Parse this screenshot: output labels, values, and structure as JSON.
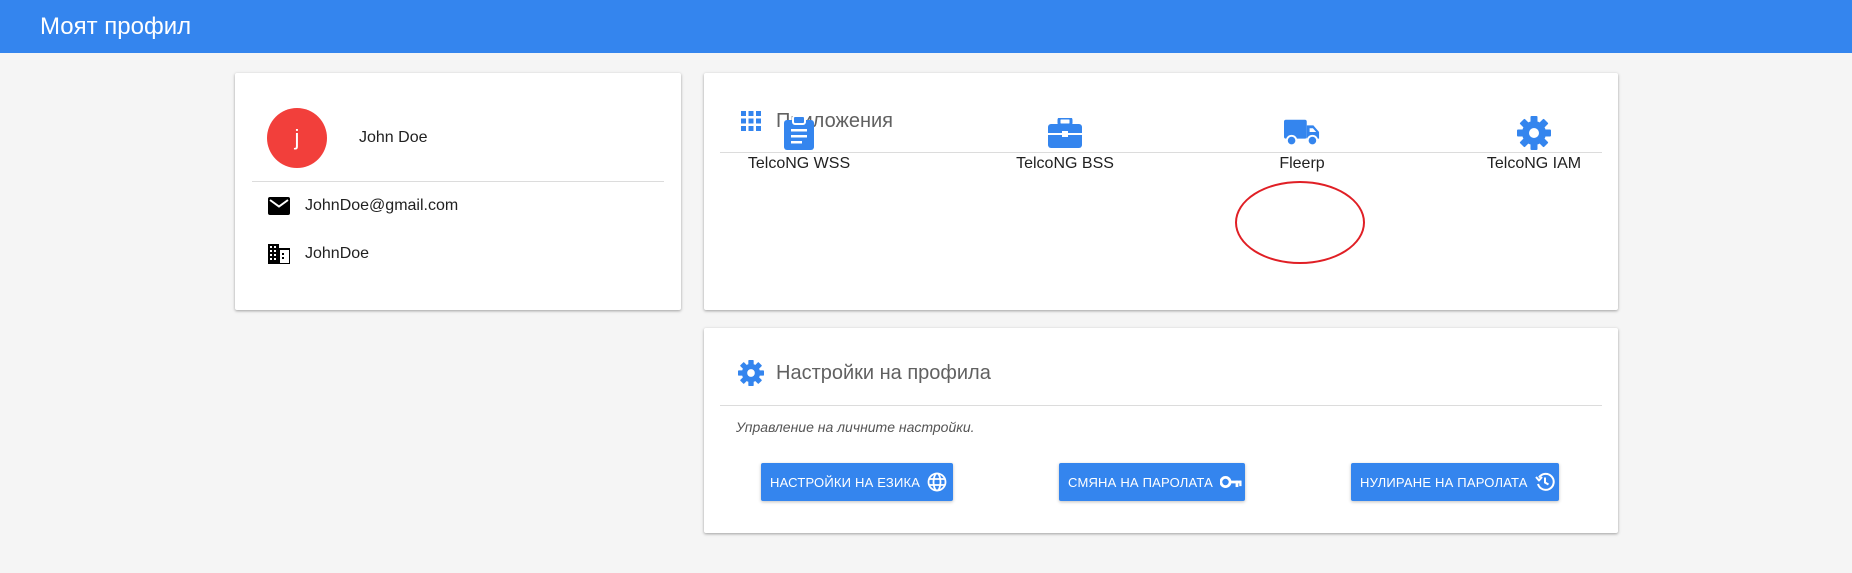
{
  "header": {
    "title": "Моят профил",
    "color": "#3485ee"
  },
  "profile": {
    "avatar_letter": "j",
    "avatar_color": "#f23f3b",
    "name": "John Doe",
    "email": "JohnDoe@gmail.com",
    "company": "JohnDoe",
    "email_icon": "mail-icon",
    "company_icon": "building-icon"
  },
  "apps": {
    "title": "Приложения",
    "icon": "apps-grid-icon",
    "items": [
      {
        "label": "TelcoNG WSS",
        "icon": "clipboard-icon"
      },
      {
        "label": "TelcoNG BSS",
        "icon": "briefcase-icon"
      },
      {
        "label": "Fleerp",
        "icon": "truck-icon",
        "highlighted": true
      },
      {
        "label": "TelcoNG IAM",
        "icon": "gear-icon"
      }
    ],
    "accent_color": "#3485ee",
    "highlight_color": "#e01f25"
  },
  "settings": {
    "title": "Настройки на профила",
    "icon": "gear-icon",
    "subtitle": "Управление на личните настройки.",
    "buttons": [
      {
        "label": "НАСТРОЙКИ НА ЕЗИКА",
        "icon": "globe-icon"
      },
      {
        "label": "СМЯНА НА ПАРОЛАТА",
        "icon": "key-icon"
      },
      {
        "label": "НУЛИРАНЕ НА ПАРОЛАТА",
        "icon": "history-icon"
      }
    ]
  }
}
